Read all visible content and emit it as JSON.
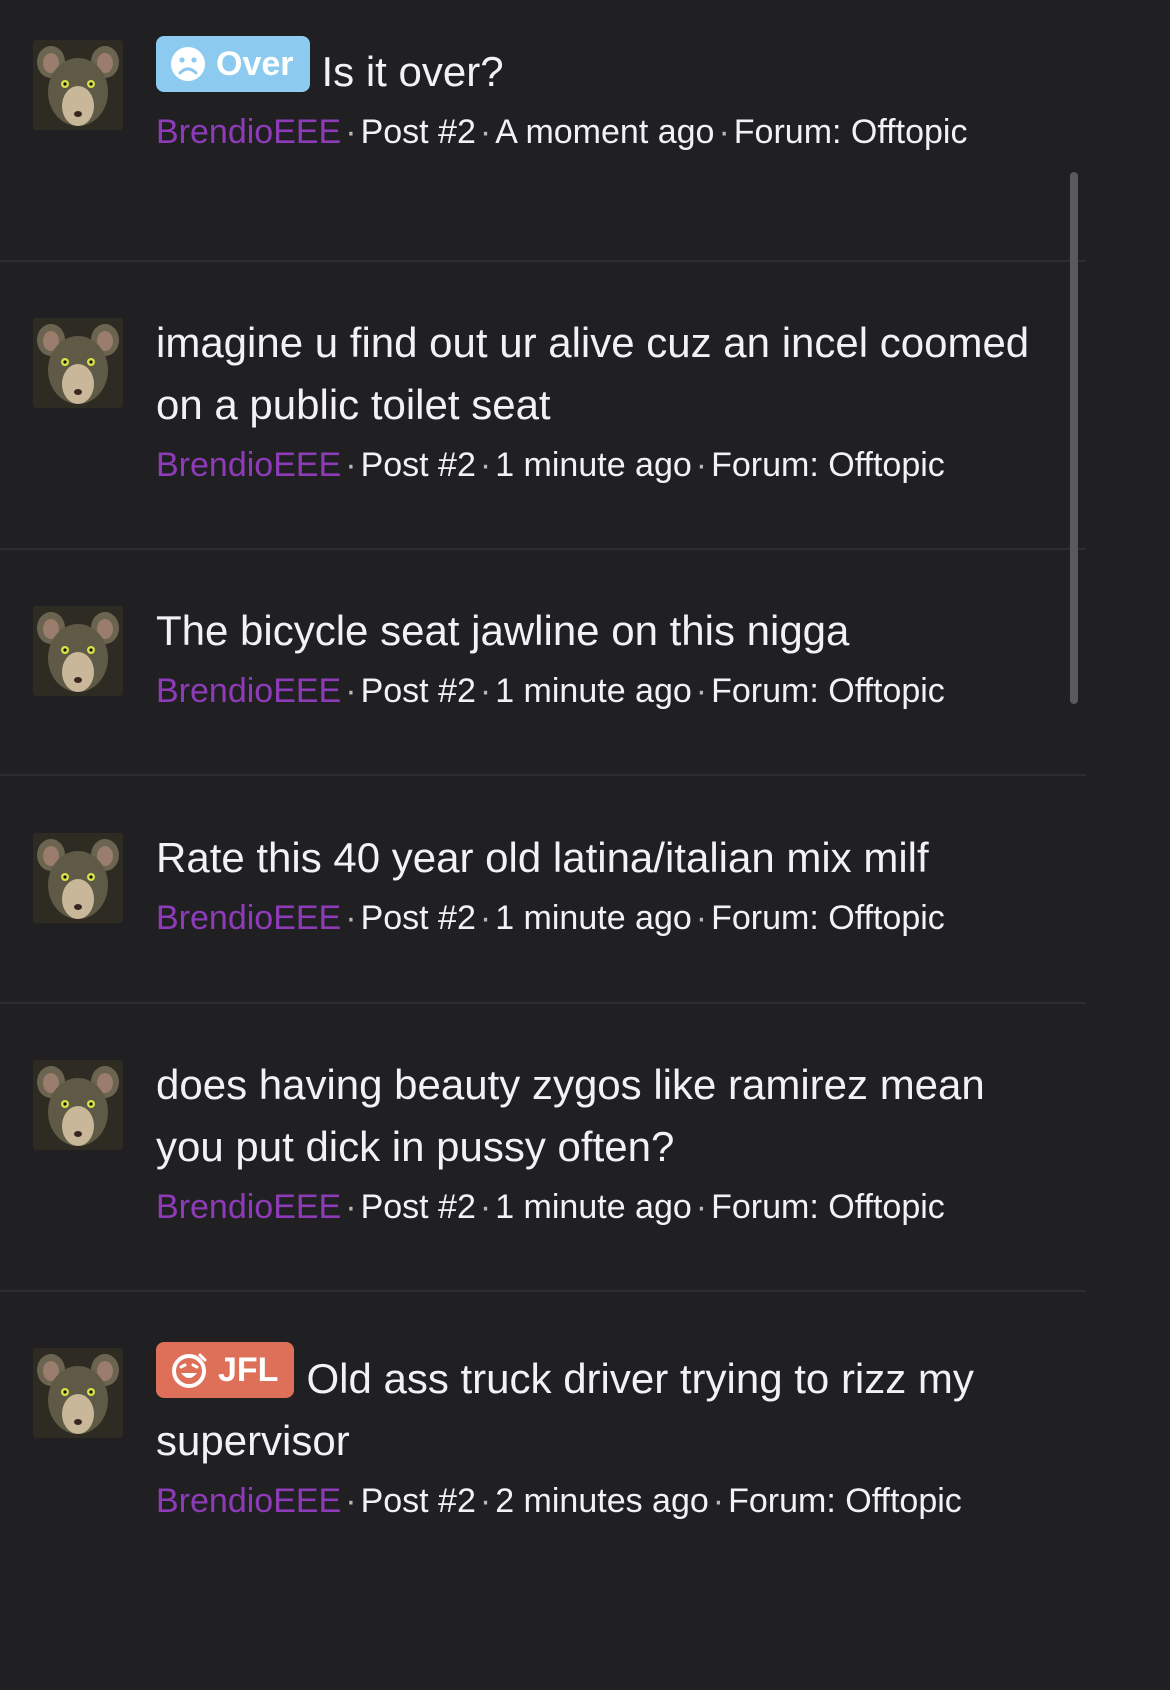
{
  "colors": {
    "background": "#202022",
    "author": "#8e3bb8",
    "over_tag": "#8ccbef",
    "jfl_tag": "#de6f58"
  },
  "threads": [
    {
      "tag": {
        "label": "Over",
        "icon": "sad-face-icon"
      },
      "title": "Is it over?",
      "author": "BrendioEEE",
      "post": "Post #2",
      "time": "A moment ago",
      "forum": "Forum: Offtopic"
    },
    {
      "title": "imagine u find out ur alive cuz an incel coomed on a public toilet seat",
      "author": "BrendioEEE",
      "post": "Post #2",
      "time": "1 minute ago",
      "forum": "Forum: Offtopic"
    },
    {
      "title": "The bicycle seat jawline on this nigga",
      "author": "BrendioEEE",
      "post": "Post #2",
      "time": "1 minute ago",
      "forum": "Forum: Offtopic"
    },
    {
      "title": "Rate this 40 year old latina/italian mix milf",
      "author": "BrendioEEE",
      "post": "Post #2",
      "time": "1 minute ago",
      "forum": "Forum: Offtopic"
    },
    {
      "title": "does having beauty zygos like ramirez mean you put dick in pussy often?",
      "author": "BrendioEEE",
      "post": "Post #2",
      "time": "1 minute ago",
      "forum": "Forum: Offtopic"
    },
    {
      "tag": {
        "label": "JFL",
        "icon": "laughing-face-icon"
      },
      "title": "Old ass truck driver trying to rizz my supervisor",
      "author": "BrendioEEE",
      "post": "Post #2",
      "time": "2 minutes ago",
      "forum": "Forum: Offtopic"
    }
  ]
}
